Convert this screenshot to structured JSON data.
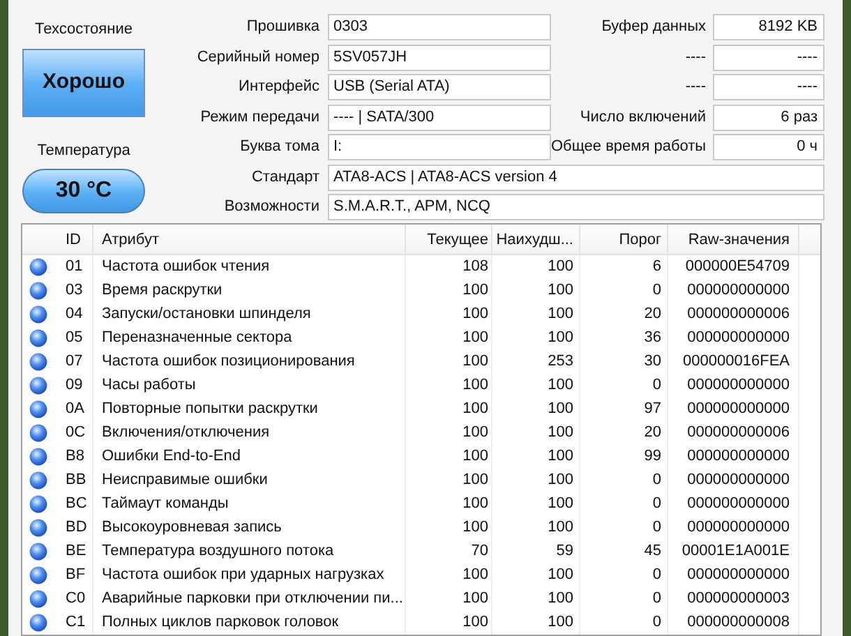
{
  "health": {
    "label": "Техсостояние",
    "status": "Хорошо"
  },
  "temperature": {
    "label": "Температура",
    "value": "30 °C"
  },
  "info_left": [
    {
      "label": "Прошивка",
      "value": "0303"
    },
    {
      "label": "Серийный номер",
      "value": "5SV057JH"
    },
    {
      "label": "Интерфейс",
      "value": "USB (Serial ATA)"
    },
    {
      "label": "Режим передачи",
      "value": "---- | SATA/300"
    },
    {
      "label": "Буква тома",
      "value": "I:"
    }
  ],
  "info_right": [
    {
      "label": "Буфер данных",
      "value": "8192 KB"
    },
    {
      "label": "----",
      "value": "----"
    },
    {
      "label": "----",
      "value": "----"
    },
    {
      "label": "Число включений",
      "value": "6 раз"
    },
    {
      "label": "Общее время работы",
      "value": "0 ч"
    }
  ],
  "info_wide": [
    {
      "label": "Стандарт",
      "value": "ATA8-ACS | ATA8-ACS version 4"
    },
    {
      "label": "Возможности",
      "value": "S.M.A.R.T., APM, NCQ"
    }
  ],
  "table": {
    "columns": [
      "ID",
      "Атрибут",
      "Текущее",
      "Наихудш...",
      "Порог",
      "Raw-значения"
    ],
    "rows": [
      [
        "01",
        "Частота ошибок чтения",
        "108",
        "100",
        "6",
        "000000E54709"
      ],
      [
        "03",
        "Время раскрутки",
        "100",
        "100",
        "0",
        "000000000000"
      ],
      [
        "04",
        "Запуски/остановки шпинделя",
        "100",
        "100",
        "20",
        "000000000006"
      ],
      [
        "05",
        "Переназначенные сектора",
        "100",
        "100",
        "36",
        "000000000000"
      ],
      [
        "07",
        "Частота ошибок позиционирования",
        "100",
        "253",
        "30",
        "000000016FEA"
      ],
      [
        "09",
        "Часы работы",
        "100",
        "100",
        "0",
        "000000000000"
      ],
      [
        "0A",
        "Повторные попытки раскрутки",
        "100",
        "100",
        "97",
        "000000000000"
      ],
      [
        "0C",
        "Включения/отключения",
        "100",
        "100",
        "20",
        "000000000006"
      ],
      [
        "B8",
        "Ошибки End-to-End",
        "100",
        "100",
        "99",
        "000000000000"
      ],
      [
        "BB",
        "Неисправимые ошибки",
        "100",
        "100",
        "0",
        "000000000000"
      ],
      [
        "BC",
        "Таймаут команды",
        "100",
        "100",
        "0",
        "000000000000"
      ],
      [
        "BD",
        "Высокоуровневая запись",
        "100",
        "100",
        "0",
        "000000000000"
      ],
      [
        "BE",
        "Температура воздушного потока",
        "70",
        "59",
        "45",
        "00001E1A001E"
      ],
      [
        "BF",
        "Частота ошибок при ударных нагрузках",
        "100",
        "100",
        "0",
        "000000000000"
      ],
      [
        "C0",
        "Аварийные парковки при отключении пи...",
        "100",
        "100",
        "0",
        "000000000003"
      ],
      [
        "C1",
        "Полных циклов парковок головок",
        "100",
        "100",
        "0",
        "000000000008"
      ]
    ]
  }
}
